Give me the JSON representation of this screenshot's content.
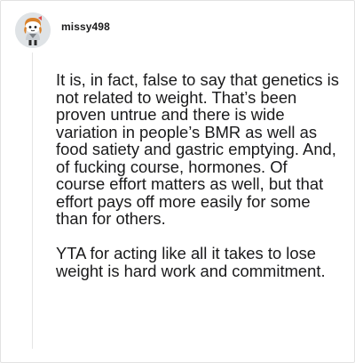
{
  "comment": {
    "username": "missy498",
    "avatar_icon": "snoo-avatar-icon",
    "paragraphs": [
      "It is, in fact, false to say that genetics is not related to weight. That’s been proven untrue and there is wide variation in people’s BMR as well as food satiety and gastric emptying. And, of fucking course, hormones. Of course effort matters as well, but that effort pays off more easily for some than for others.",
      "YTA for acting like all it takes to lose weight is hard work and commitment."
    ]
  },
  "colors": {
    "text": "#1a1a1b",
    "border": "#e2e2e2",
    "thread_line": "#e5e5e5",
    "avatar_bg": "#dfe3e6"
  }
}
